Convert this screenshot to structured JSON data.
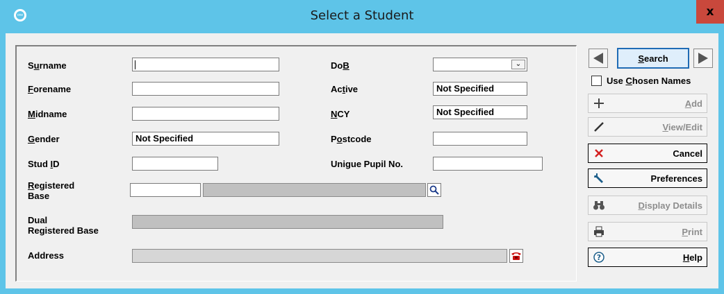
{
  "window": {
    "title": "Select a Student",
    "app_icon_text": "one",
    "close_label": "x"
  },
  "form": {
    "surname": {
      "label_pre": "S",
      "label_u": "u",
      "label_post": "rname",
      "value": ""
    },
    "forename": {
      "label_pre": "",
      "label_u": "F",
      "label_post": "orename",
      "value": ""
    },
    "midname": {
      "label_pre": "",
      "label_u": "M",
      "label_post": "idname",
      "value": ""
    },
    "gender": {
      "label_pre": "",
      "label_u": "G",
      "label_post": "ender",
      "value": "Not Specified"
    },
    "stud_id": {
      "label_pre": "Stud ",
      "label_u": "I",
      "label_post": "D",
      "value": ""
    },
    "registered_base": {
      "label_pre": "",
      "label_u": "R",
      "label_post": "egistered",
      "label_line2": "Base",
      "code": "",
      "name": ""
    },
    "dual_registered_base": {
      "label_line1": "Dual",
      "label_line2": "Registered Base",
      "value": ""
    },
    "address": {
      "label": "Address",
      "value": ""
    },
    "dob": {
      "label_pre": "Do",
      "label_u": "B",
      "label_post": "",
      "value": ""
    },
    "active": {
      "label_pre": "Ac",
      "label_u": "t",
      "label_post": "ive",
      "value": "Not Specified"
    },
    "ncy": {
      "label_pre": "",
      "label_u": "N",
      "label_post": "CY",
      "value": "Not Specified"
    },
    "postcode": {
      "label_pre": "P",
      "label_u": "o",
      "label_post": "stcode",
      "value": ""
    },
    "upn": {
      "label": "Unigue Pupil No.",
      "value": ""
    }
  },
  "actions": {
    "search": {
      "label_u": "S",
      "label_post": "earch"
    },
    "use_chosen_names": {
      "label_pre": "Use ",
      "label_u": "C",
      "label_post": "hosen Names",
      "checked": false
    },
    "add": {
      "label_u": "A",
      "label_post": "dd",
      "enabled": false
    },
    "view_edit": {
      "label_u": "V",
      "label_post": "iew/Edit",
      "enabled": false
    },
    "cancel": {
      "label": "Cancel",
      "enabled": true
    },
    "preferences": {
      "label": "Preferences",
      "enabled": true
    },
    "display_details": {
      "label_u": "D",
      "label_post": "isplay Details",
      "enabled": false
    },
    "print": {
      "label_u": "P",
      "label_post": "rint",
      "enabled": false
    },
    "help": {
      "label_u": "H",
      "label_post": "elp",
      "enabled": true
    }
  },
  "icons": {
    "prev": "triangle-left-icon",
    "next": "triangle-right-icon",
    "add": "plus-icon",
    "view_edit": "pencil-icon",
    "cancel": "red-x-icon",
    "preferences": "wrench-icon",
    "display_details": "binoculars-icon",
    "print": "printer-icon",
    "help": "help-icon",
    "lookup": "magnifier-icon",
    "address": "telephone-icon",
    "dropdown": "chevron-down-icon"
  },
  "colors": {
    "titlebar": "#5ec4e8",
    "close": "#c9483c",
    "cancel_x": "#d42020",
    "phone": "#cc1111"
  }
}
